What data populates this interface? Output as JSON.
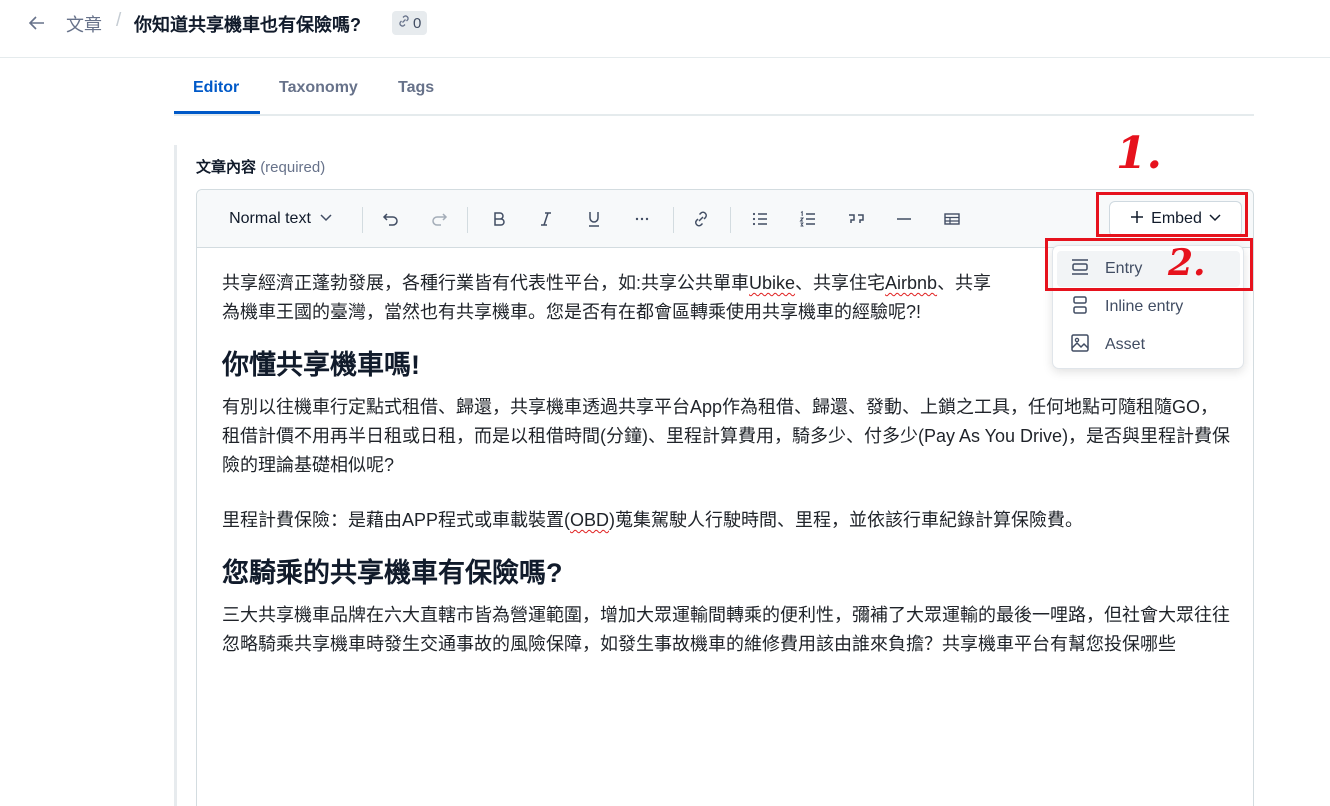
{
  "header": {
    "back_icon": "arrow-left-icon",
    "breadcrumb": "文章",
    "separator": "/",
    "title": "你知道共享機車也有保險嗎?",
    "reference_count": "0",
    "reference_icon": "link-icon"
  },
  "tabs": [
    {
      "label": "Editor",
      "active": true
    },
    {
      "label": "Taxonomy",
      "active": false
    },
    {
      "label": "Tags",
      "active": false
    }
  ],
  "field": {
    "label": "文章內容",
    "required": "(required)"
  },
  "toolbar": {
    "text_style": "Normal text",
    "icons": [
      "undo-icon",
      "redo-icon",
      "bold-icon",
      "italic-icon",
      "underline-icon",
      "more-icon",
      "link-icon",
      "bulleted-list-icon",
      "numbered-list-icon",
      "quote-icon",
      "horizontal-rule-icon",
      "table-icon"
    ],
    "embed_label": "Embed"
  },
  "embed_menu": {
    "items": [
      {
        "label": "Entry",
        "icon": "entry-block-icon"
      },
      {
        "label": "Inline entry",
        "icon": "inline-entry-icon"
      },
      {
        "label": "Asset",
        "icon": "image-icon"
      }
    ]
  },
  "content": {
    "p1_a": "共享經濟正蓬勃發展，各種行業皆有代表性平台，如:共享公共單車",
    "p1_ubike": "Ubike",
    "p1_b": "、共享住宅",
    "p1_airbnb": "Airbnb",
    "p1_c": "、共享",
    "p1_line2": "為機車王國的臺灣，當然也有共享機車。您是否有在都會區轉乘使用共享機車的經驗呢?!",
    "h1": "你懂共享機車嗎!",
    "p2": "有別以往機車行定點式租借、歸還，共享機車透過共享平台App作為租借、歸還、發動、上鎖之工具，任何地點可隨租隨GO，租借計價不用再半日租或日租，而是以租借時間(分鐘)、里程計算費用，騎多少、付多少(Pay As You Drive)，是否與里程計費保險的理論基礎相似呢?",
    "p3_a": "里程計費保險：是藉由APP程式或車載裝置(",
    "p3_obd": "OBD",
    "p3_b": ")蒐集駕駛人行駛時間、里程，並依該行車紀錄計算保險費。",
    "h2": "您騎乘的共享機車有保險嗎?",
    "p4": "三大共享機車品牌在六大直轄市皆為營運範圍，增加大眾運輸間轉乘的便利性，彌補了大眾運輸的最後一哩路，但社會大眾往往忽略騎乘共享機車時發生交通事故的風險保障，如發生事故機車的維修費用該由誰來負擔？共享機車平台有幫您投保哪些"
  },
  "annotations": {
    "step1": "1.",
    "step2": "2.",
    "color": "#e6121d"
  },
  "colors": {
    "accent": "#0059c8",
    "text": "#1f2329",
    "muted": "#67728a"
  }
}
